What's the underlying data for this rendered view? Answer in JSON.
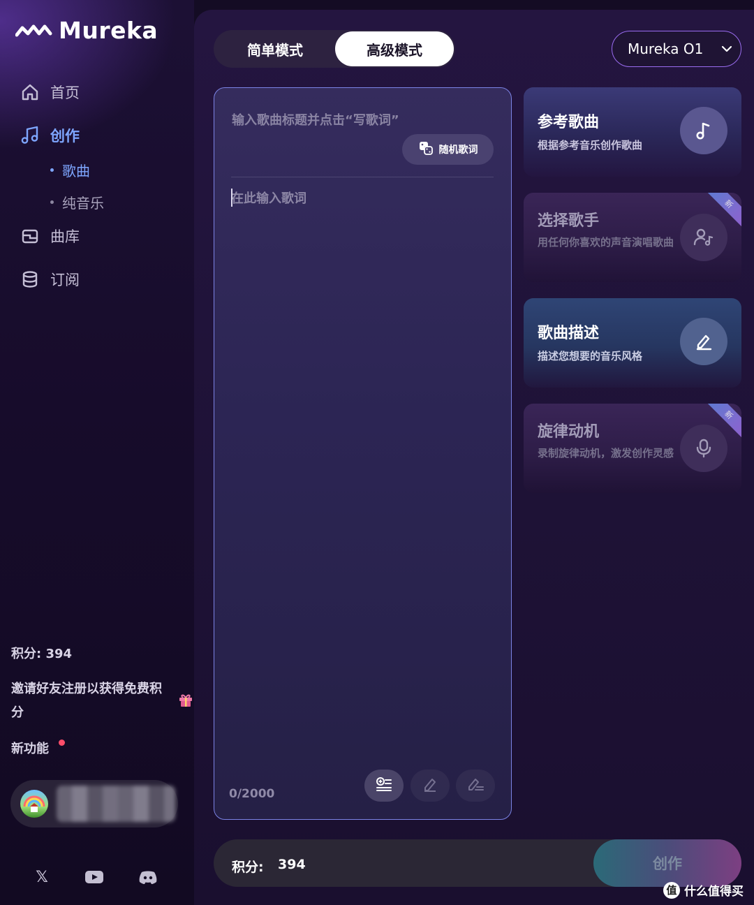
{
  "brand": {
    "name": "Mureka"
  },
  "sidebar": {
    "nav": [
      {
        "label": "首页",
        "icon": "home-icon"
      },
      {
        "label": "创作",
        "icon": "music-note-icon"
      },
      {
        "label": "曲库",
        "icon": "library-icon"
      },
      {
        "label": "订阅",
        "icon": "database-icon"
      }
    ],
    "create_sub": [
      {
        "label": "歌曲"
      },
      {
        "label": "纯音乐"
      }
    ],
    "credits_text": "积分: 394",
    "invite_text": "邀请好友注册以获得免费积分",
    "new_features": "新功能",
    "social_icons": [
      "x-icon",
      "youtube-icon",
      "discord-icon"
    ]
  },
  "header": {
    "mode_simple": "简单模式",
    "mode_advanced": "高级模式",
    "model": "Mureka O1"
  },
  "editor": {
    "title_placeholder": "输入歌曲标题并点击“写歌词”",
    "random_lyrics": "随机歌词",
    "lyrics_placeholder": "在此输入歌词",
    "counter": "0/2000"
  },
  "cards": [
    {
      "title": "参考歌曲",
      "desc": "根据参考音乐创作歌曲",
      "icon": "music-note-icon",
      "is_new": false
    },
    {
      "title": "选择歌手",
      "desc": "用任何你喜欢的声音演唱歌曲",
      "icon": "singer-icon",
      "is_new": true,
      "badge": "新"
    },
    {
      "title": "歌曲描述",
      "desc": "描述您想要的音乐风格",
      "icon": "pen-icon",
      "is_new": false
    },
    {
      "title": "旋律动机",
      "desc": "录制旋律动机，激发创作灵感",
      "icon": "microphone-icon",
      "is_new": true,
      "badge": "新"
    }
  ],
  "bottom": {
    "credits_label": "积分:",
    "credits_value": "394",
    "create_button": "创作"
  },
  "watermark": {
    "glyph": "值",
    "text": "什么值得买"
  },
  "colors": {
    "accent": "#7ea6ff",
    "border": "#7c84e6",
    "model_border": "#9a6cf0",
    "notify_dot": "#ff4d6a"
  }
}
